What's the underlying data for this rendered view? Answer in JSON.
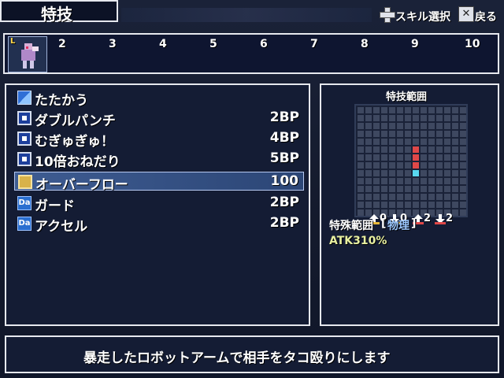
{
  "header": {
    "title": "特技",
    "hint_skill": "スキル選択",
    "hint_back": "戻る"
  },
  "slots": {
    "numbers": [
      "2",
      "3",
      "4",
      "5",
      "6",
      "7",
      "8",
      "9",
      "10"
    ],
    "first_badge": "L"
  },
  "skills": [
    {
      "name": "たたかう",
      "cost": "",
      "icon": "attack-icon"
    },
    {
      "name": "ダブルパンチ",
      "cost": "2BP",
      "icon": "skill-icon"
    },
    {
      "name": "むぎゅぎゅ！",
      "cost": "4BP",
      "icon": "skill-icon"
    },
    {
      "name": "10倍おねだり",
      "cost": "5BP",
      "icon": "skill-icon"
    },
    {
      "name": "オーバーフロー",
      "cost": "100",
      "icon": "overflow-icon",
      "selected": true
    },
    {
      "name": "ガード",
      "cost": "2BP",
      "icon": "da-icon",
      "icon_text": "Da"
    },
    {
      "name": "アクセル",
      "cost": "2BP",
      "icon": "da-icon",
      "icon_text": "Da"
    }
  ],
  "range": {
    "title": "特技範囲",
    "modifiers": [
      "0",
      "0",
      "2",
      "2"
    ],
    "type_label": "特殊範囲",
    "type_value": "物理",
    "atk_text": "ATK310%",
    "colors": {
      "red": "#e04848",
      "cyan": "#58d8f0",
      "cell": "#3e4860"
    }
  },
  "message": "暴走したロボットアームで相手をタコ殴りにします"
}
